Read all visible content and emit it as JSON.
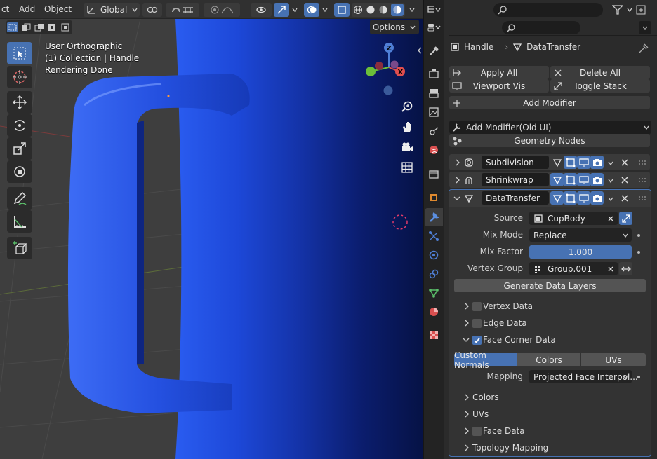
{
  "header": {
    "menus": [
      "ct",
      "Add",
      "Object"
    ],
    "orientation_label": "Global",
    "options_label": "Options"
  },
  "viewport": {
    "overlay_lines": [
      "User Orthographic",
      "(1) Collection | Handle",
      "Rendering Done"
    ],
    "gizmo": {
      "z": "Z",
      "y": "Y",
      "x": "X"
    }
  },
  "properties": {
    "search_placeholder": "",
    "breadcrumb": {
      "object": "Handle",
      "modifier": "DataTransfer"
    },
    "apply_all": "Apply All",
    "delete_all": "Delete All",
    "viewport_vis": "Viewport Vis",
    "toggle_stack": "Toggle Stack",
    "add_modifier": "Add Modifier",
    "add_modifier_old": "Add Modifier(Old UI)",
    "geometry_nodes": "Geometry Nodes",
    "modifiers": [
      {
        "name": "Subdivision"
      },
      {
        "name": "Shrinkwrap"
      },
      {
        "name": "DataTransfer"
      }
    ],
    "datatransfer": {
      "source_label": "Source",
      "source_value": "CupBody",
      "mix_mode_label": "Mix Mode",
      "mix_mode_value": "Replace",
      "mix_factor_label": "Mix Factor",
      "mix_factor_value": "1.000",
      "vertex_group_label": "Vertex Group",
      "vertex_group_value": "Group.001",
      "generate_label": "Generate Data Layers",
      "vertex_data": "Vertex Data",
      "edge_data": "Edge Data",
      "face_corner_data": "Face Corner Data",
      "tabs": [
        "Custom Normals",
        "Colors",
        "UVs"
      ],
      "mapping_label": "Mapping",
      "mapping_value": "Projected Face Interpol...",
      "colors_sub": "Colors",
      "uvs_sub": "UVs",
      "face_data": "Face Data",
      "topology_mapping": "Topology Mapping"
    }
  },
  "colors": {
    "accent": "#4772b3",
    "mug": "#1f47d8"
  }
}
